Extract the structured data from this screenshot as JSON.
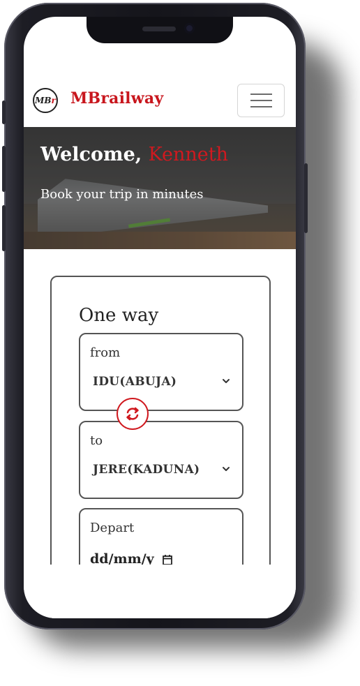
{
  "app": {
    "logo_text": "MBr",
    "brand_prefix": "MB",
    "brand_suffix": "railway"
  },
  "hero": {
    "greeting": "Welcome,",
    "user_name": "Kenneth",
    "subtitle": "Book your trip in minutes"
  },
  "booking": {
    "trip_type": "One way",
    "from_label": "from",
    "from_value": "IDU(ABUJA)",
    "to_label": "to",
    "to_value": "JERE(KADUNA)",
    "depart_label": "Depart",
    "depart_value": "dd/mm/y"
  },
  "colors": {
    "brand_red": "#c8161d",
    "border_gray": "#555555"
  },
  "icons": [
    "menu-icon",
    "chevron-down-icon",
    "swap-icon",
    "calendar-icon"
  ]
}
